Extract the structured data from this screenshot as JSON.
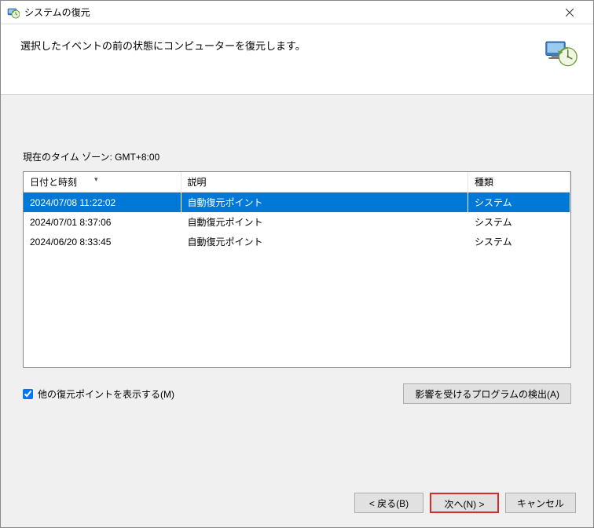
{
  "window": {
    "title": "システムの復元"
  },
  "header": {
    "text": "選択したイベントの前の状態にコンピューターを復元します。"
  },
  "content": {
    "timezone_label": "現在のタイム ゾーン: GMT+8:00",
    "columns": {
      "date": "日付と時刻",
      "desc": "説明",
      "type": "種類"
    },
    "rows": [
      {
        "date": "2024/07/08 11:22:02",
        "desc": "自動復元ポイント",
        "type": "システム",
        "selected": true
      },
      {
        "date": "2024/07/01 8:37:06",
        "desc": "自動復元ポイント",
        "type": "システム",
        "selected": false
      },
      {
        "date": "2024/06/20 8:33:45",
        "desc": "自動復元ポイント",
        "type": "システム",
        "selected": false
      }
    ],
    "show_more_label": "他の復元ポイントを表示する(M)",
    "scan_label": "影響を受けるプログラムの検出(A)"
  },
  "footer": {
    "back": "< 戻る(B)",
    "next": "次へ(N) >",
    "cancel": "キャンセル"
  }
}
